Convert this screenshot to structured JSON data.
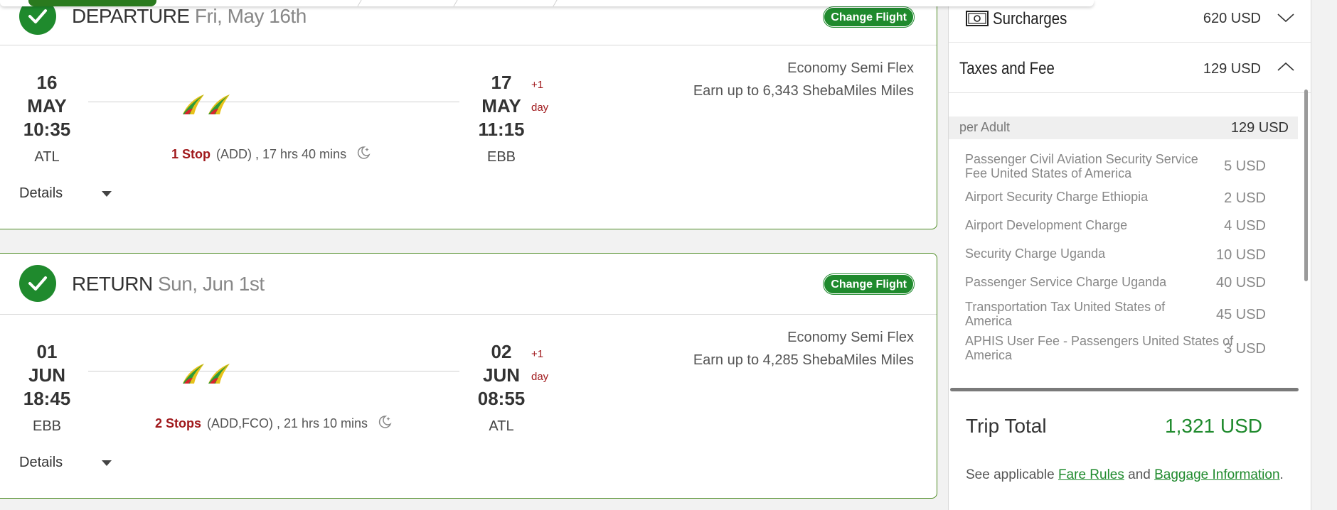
{
  "departure": {
    "label": "DEPARTURE",
    "date": "Fri, May 16th",
    "change_label": "Change Flight",
    "depart": {
      "day": "16",
      "month": "MAY",
      "time": "10:35",
      "code": "ATL"
    },
    "arrive": {
      "day": "17",
      "month": "MAY",
      "time": "11:15",
      "code": "EBB"
    },
    "plus_day": "+1",
    "plus_day_unit": "day",
    "stops_label": "1 Stop",
    "stops_detail": "(ADD) , 17 hrs 40 mins",
    "fare_class": "Economy Semi Flex",
    "miles": "Earn up to 6,343 ShebaMiles Miles",
    "details_label": "Details"
  },
  "return": {
    "label": "RETURN",
    "date": "Sun, Jun 1st",
    "change_label": "Change Flight",
    "depart": {
      "day": "01",
      "month": "JUN",
      "time": "18:45",
      "code": "EBB"
    },
    "arrive": {
      "day": "02",
      "month": "JUN",
      "time": "08:55",
      "code": "ATL"
    },
    "plus_day": "+1",
    "plus_day_unit": "day",
    "stops_label": "2 Stops",
    "stops_detail": "(ADD,FCO) , 21 hrs 10 mins",
    "fare_class": "Economy Semi Flex",
    "miles": "Earn up to 4,285 ShebaMiles Miles",
    "details_label": "Details"
  },
  "price": {
    "surcharges_label": "Surcharges",
    "surcharges_amount": "620 USD",
    "taxes_label": "Taxes and Fee",
    "taxes_amount": "129 USD",
    "per_adult_label": "per Adult",
    "per_adult_amount": "129 USD",
    "fees": [
      {
        "label": "Passenger Civil Aviation Security Service Fee United States of America",
        "amount": "5 USD"
      },
      {
        "label": "Airport Security Charge Ethiopia",
        "amount": "2 USD"
      },
      {
        "label": "Airport Development Charge",
        "amount": "4 USD"
      },
      {
        "label": "Security Charge Uganda",
        "amount": "10 USD"
      },
      {
        "label": "Passenger Service Charge Uganda",
        "amount": "40 USD"
      },
      {
        "label": "Transportation Tax United States of America",
        "amount": "45 USD"
      },
      {
        "label": "APHIS User Fee - Passengers United States of America",
        "amount": "3 USD"
      }
    ],
    "total_label": "Trip Total",
    "total_amount": "1,321 USD",
    "rules_prefix": "See applicable ",
    "fare_rules_link": "Fare Rules",
    "rules_and": " and ",
    "baggage_link": "Baggage Information",
    "rules_suffix": "."
  },
  "colors": {
    "brand_green": "#1f8a2d",
    "border_green": "#4d8b24",
    "stop_red": "#a0191c"
  },
  "icons": {
    "check": "check-icon",
    "moon": "night-flight-icon",
    "money": "banknote-icon",
    "chevron_down": "chevron-down-icon",
    "chevron_up": "chevron-up-icon",
    "caret": "caret-down-icon",
    "logo": "airline-logo-icon"
  }
}
